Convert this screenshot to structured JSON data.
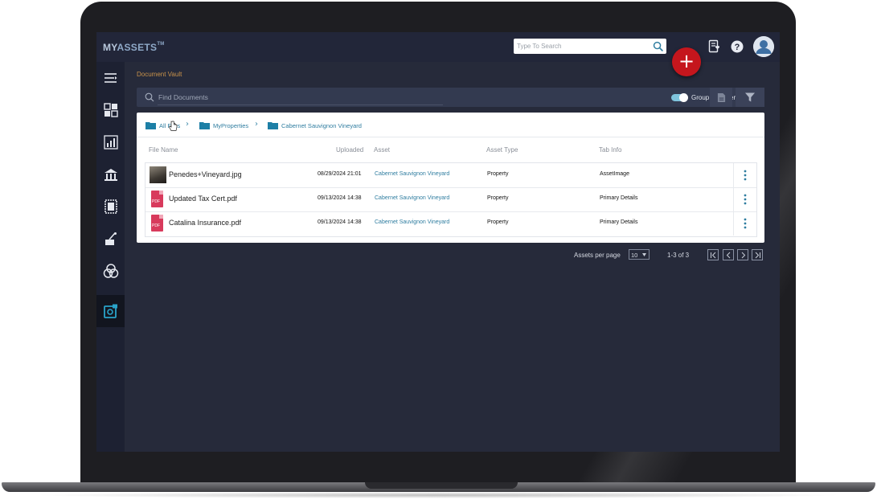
{
  "app": {
    "logo_prefix": "MY",
    "logo_main": "ASSETS",
    "logo_tm": "TM"
  },
  "search": {
    "placeholder": "Type To Search",
    "value": ""
  },
  "header_icons": [
    "document-heart-icon",
    "help-icon",
    "user-avatar-icon"
  ],
  "fab": {
    "label": "+"
  },
  "sidebar": {
    "items": [
      {
        "icon": "menu-toggle-icon"
      },
      {
        "icon": "dashboard-icon"
      },
      {
        "icon": "analytics-chart-icon"
      },
      {
        "icon": "bank-institution-icon"
      },
      {
        "icon": "portfolio-frame-icon"
      },
      {
        "icon": "asset-tools-icon"
      },
      {
        "icon": "circles-group-icon"
      },
      {
        "icon": "document-vault-icon",
        "active": true
      }
    ]
  },
  "page": {
    "title": "Document Vault"
  },
  "find": {
    "placeholder": "Find Documents"
  },
  "group_by_folder": {
    "label": "Group by folder",
    "enabled": true
  },
  "breadcrumb": [
    {
      "label": "All Files"
    },
    {
      "label": "MyProperties"
    },
    {
      "label": "Cabernet Sauvignon Vineyard"
    }
  ],
  "table": {
    "columns": [
      "File Name",
      "Uploaded",
      "Asset",
      "Asset Type",
      "Tab Info"
    ],
    "rows": [
      {
        "file": "Penedes+Vineyard.jpg",
        "kind": "image",
        "uploaded": "08/29/2024 21:01",
        "asset": "Cabernet Sauvignon Vineyard",
        "asset_type": "Property",
        "tab_info": "AssetImage"
      },
      {
        "file": "Updated Tax Cert.pdf",
        "kind": "pdf",
        "uploaded": "09/13/2024 14:38",
        "asset": "Cabernet Sauvignon Vineyard",
        "asset_type": "Property",
        "tab_info": "Primary Details"
      },
      {
        "file": "Catalina Insurance.pdf",
        "kind": "pdf",
        "uploaded": "09/13/2024 14:38",
        "asset": "Cabernet Sauvignon Vineyard",
        "asset_type": "Property",
        "tab_info": "Primary Details"
      }
    ],
    "pdf_badge": "PDF"
  },
  "pagination": {
    "label": "Assets per page",
    "per_page": "10",
    "range": "1-3 of 3"
  },
  "colors": {
    "accent": "#2f7da0",
    "fab": "#c5161d",
    "title": "#c8924a",
    "background": "#262a3a"
  }
}
